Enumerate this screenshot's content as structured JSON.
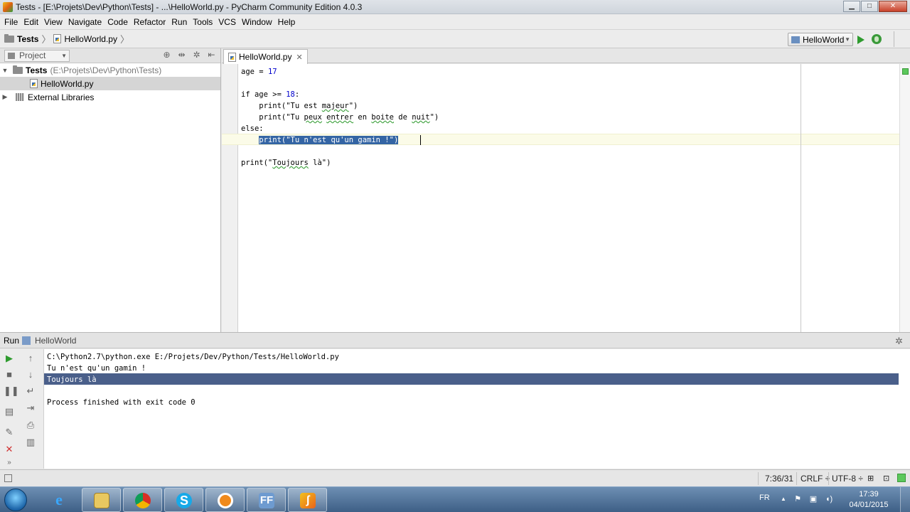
{
  "window": {
    "title": "Tests - [E:\\Projets\\Dev\\Python\\Tests] - ...\\HelloWorld.py - PyCharm Community Edition 4.0.3",
    "minimize": "▁",
    "maximize": "□",
    "close": "✕"
  },
  "menu": [
    "File",
    "Edit",
    "View",
    "Navigate",
    "Code",
    "Refactor",
    "Run",
    "Tools",
    "VCS",
    "Window",
    "Help"
  ],
  "navbar": {
    "project": "Tests",
    "file": "HelloWorld.py",
    "run_config": "HelloWorld"
  },
  "project_panel": {
    "view_label": "Project",
    "tree": [
      {
        "label": "Tests",
        "path": "(E:\\Projets\\Dev\\Python\\Tests)",
        "arrow": "▼"
      },
      {
        "label": "HelloWorld.py"
      },
      {
        "label": "External Libraries",
        "arrow": "▶"
      }
    ]
  },
  "editor": {
    "tab_label": "HelloWorld.py",
    "tab_close": "✕",
    "lines": [
      "age = 17",
      "",
      "if age >= 18:",
      "    print(\"Tu est majeur\")",
      "    print(\"Tu peux entrer en boite de nuit\")",
      "else:",
      "    print(\"Tu n'est qu'un gamin !\")",
      "",
      "print(\"Toujours là\")"
    ],
    "line_1_prefix": "age = ",
    "line_1_num": "17",
    "line_3_prefix": "if age >= ",
    "line_3_num": "18",
    "line_3_suffix": ":",
    "line_4_prefix": "    print(\"Tu est ",
    "line_4_squig": "majeur",
    "line_4_suffix": "\")",
    "line_5_prefix": "    print(\"Tu ",
    "line_5_w1": "peux",
    "line_5_mid1": " ",
    "line_5_w2": "entrer",
    "line_5_mid2": " en ",
    "line_5_w3": "boite",
    "line_5_mid3": " de ",
    "line_5_w4": "nuit",
    "line_5_suffix": "\")",
    "line_6": "else:",
    "line_7_indent": "    ",
    "line_7_selected": "print(\"Tu n'est qu'un gamin !\")",
    "line_9_prefix": "print(\"",
    "line_9_squig": "Toujours",
    "line_9_suffix": " là\")"
  },
  "run_panel": {
    "title": "Run",
    "config": "HelloWorld",
    "output": [
      "C:\\Python2.7\\python.exe E:/Projets/Dev/Python/Tests/HelloWorld.py",
      "Tu n'est qu'un gamin !",
      "Toujours là",
      "",
      "Process finished with exit code 0"
    ]
  },
  "statusbar": {
    "position": "7:36/31",
    "line_sep": "CRLF ÷",
    "encoding": "UTF-8 ÷"
  },
  "taskbar": {
    "apps": [
      "Internet Explorer",
      "Explorer",
      "Chrome",
      "Skype",
      "Blender",
      "FF",
      "PyCharm"
    ],
    "ff_label": "FF",
    "lang": "FR",
    "time": "17:39",
    "date": "04/01/2015"
  },
  "colors": {
    "selection": "#3465a4",
    "console_selection": "#4a5f8a",
    "run_green": "#2e9b2e"
  }
}
